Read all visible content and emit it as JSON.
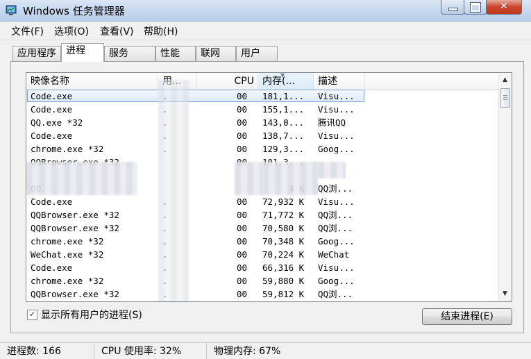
{
  "window": {
    "title": "Windows 任务管理器",
    "controls": {
      "minimize_icon": "minimize-icon",
      "maximize_icon": "maximize-icon",
      "close_icon": "close-icon",
      "close_glyph": "✕"
    }
  },
  "menu": [
    "文件(F)",
    "选项(O)",
    "查看(V)",
    "帮助(H)"
  ],
  "tabs": [
    "应用程序",
    "进程",
    "服务",
    "性能",
    "联网",
    "用户"
  ],
  "active_tab": "进程",
  "table": {
    "columns": {
      "name": "映像名称",
      "user": "用...",
      "cpu": "CPU",
      "mem": "内存(...",
      "desc": "描述"
    },
    "sorted_column": "mem",
    "rows": [
      {
        "name": "Code.exe",
        "user": ".",
        "cpu": "00",
        "mem": "181,1...",
        "desc": "Visu..."
      },
      {
        "name": "Code.exe",
        "user": ".",
        "cpu": "00",
        "mem": "155,1...",
        "desc": "Visu..."
      },
      {
        "name": "QQ.exe *32",
        "user": ".",
        "cpu": "00",
        "mem": "143,0...",
        "desc": "腾讯QQ"
      },
      {
        "name": "Code.exe",
        "user": ".",
        "cpu": "00",
        "mem": "138,7...",
        "desc": "Visu..."
      },
      {
        "name": "chrome.exe *32",
        "user": ".",
        "cpu": "00",
        "mem": "129,3...",
        "desc": "Goog..."
      },
      {
        "name": "QQBrowser.exe *32",
        "user": "",
        "cpu": "00",
        "mem": "101,3...",
        "desc": ""
      },
      {
        "name": "",
        "user": "",
        "cpu": "",
        "mem": "",
        "desc": ""
      },
      {
        "name": "QQ",
        "user": "",
        "cpu": "",
        "mem": "4 K",
        "desc": "QQ浏..."
      },
      {
        "name": "Code.exe",
        "user": ".",
        "cpu": "00",
        "mem": "72,932 K",
        "desc": "Visu..."
      },
      {
        "name": "QQBrowser.exe *32",
        "user": ".",
        "cpu": "00",
        "mem": "71,772 K",
        "desc": "QQ浏..."
      },
      {
        "name": "QQBrowser.exe *32",
        "user": ".",
        "cpu": "00",
        "mem": "70,580 K",
        "desc": "QQ浏..."
      },
      {
        "name": "chrome.exe *32",
        "user": ".",
        "cpu": "00",
        "mem": "70,348 K",
        "desc": "Goog..."
      },
      {
        "name": "WeChat.exe *32",
        "user": ".",
        "cpu": "00",
        "mem": "70,224 K",
        "desc": "WeChat"
      },
      {
        "name": "Code.exe",
        "user": ".",
        "cpu": "00",
        "mem": "66,316 K",
        "desc": "Visu..."
      },
      {
        "name": "chrome.exe *32",
        "user": ".",
        "cpu": "00",
        "mem": "59,880 K",
        "desc": "Goog..."
      },
      {
        "name": "QQBrowser.exe *32",
        "user": ".",
        "cpu": "00",
        "mem": "59,812 K",
        "desc": "QQ浏..."
      }
    ]
  },
  "show_all_users": {
    "label": "显示所有用户的进程(S)",
    "checked": true,
    "check_glyph": "✓"
  },
  "end_process_button": "结束进程(E)",
  "status": {
    "processes": "进程数: 166",
    "cpu": "CPU 使用率: 32%",
    "memory": "物理内存: 67%"
  },
  "scroll": {
    "up": "▲",
    "down": "▼"
  },
  "colors": {
    "selection_border": "#7da2ce",
    "title_gradient": "#c4d7ee",
    "close_red": "#c9452a"
  }
}
